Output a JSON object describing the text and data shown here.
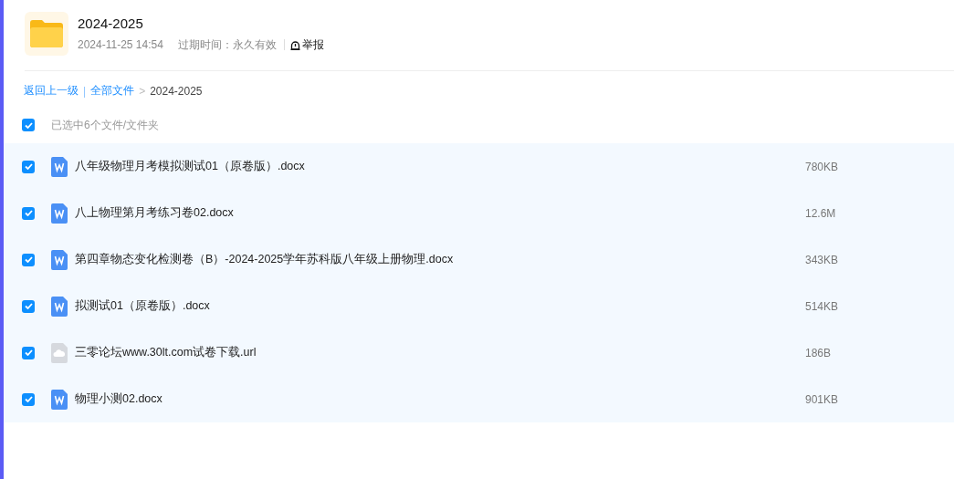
{
  "folder": {
    "name": "2024-2025",
    "date": "2024-11-25 14:54",
    "expiry": "过期时间：永久有效",
    "report": "举报"
  },
  "breadcrumb": {
    "back": "返回上一级",
    "divider": "|",
    "root": "全部文件",
    "arrow": ">",
    "current": "2024-2025"
  },
  "select_all": {
    "checked": true,
    "label": "已选中6个文件/文件夹"
  },
  "files": [
    {
      "kind": "doc",
      "name": "八年级物理月考模拟测试01（原卷版）.docx",
      "size": "780KB",
      "checked": true
    },
    {
      "kind": "doc",
      "name": "八上物理第月考练习卷02.docx",
      "size": "12.6M",
      "checked": true
    },
    {
      "kind": "doc",
      "name": "第四章物态变化检测卷（B）-2024-2025学年苏科版八年级上册物理.docx",
      "size": "343KB",
      "checked": true
    },
    {
      "kind": "doc",
      "name": "拟测试01（原卷版）.docx",
      "size": "514KB",
      "checked": true
    },
    {
      "kind": "url",
      "name": "三零论坛www.30lt.com试卷下载.url",
      "size": "186B",
      "checked": true
    },
    {
      "kind": "doc",
      "name": "物理小测02.docx",
      "size": "901KB",
      "checked": true
    }
  ]
}
